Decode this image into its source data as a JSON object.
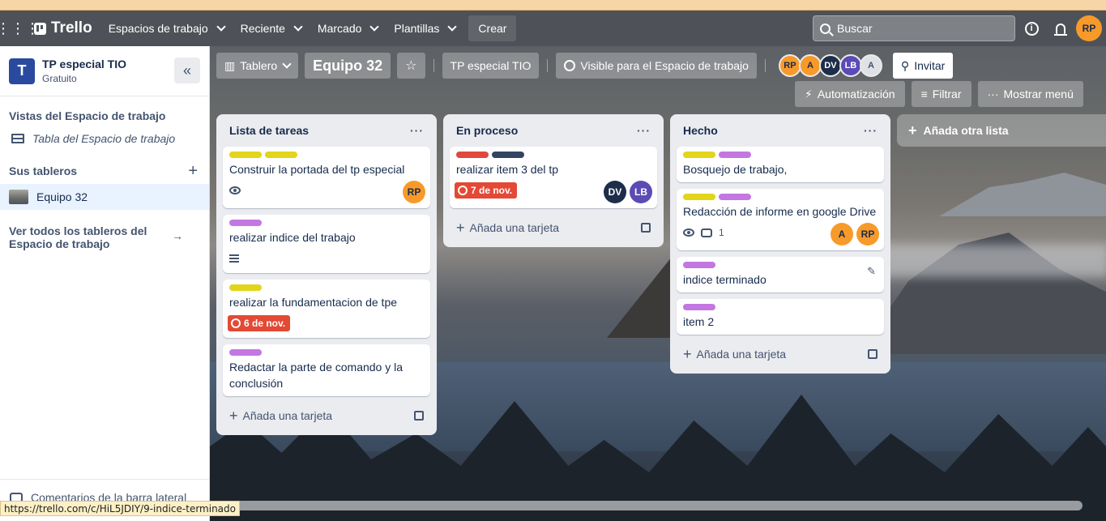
{
  "topbar": {
    "brand": "Trello",
    "nav": [
      "Espacios de trabajo",
      "Reciente",
      "Marcado",
      "Plantillas"
    ],
    "create_label": "Crear",
    "search_placeholder": "Buscar",
    "user_initials": "RP"
  },
  "sidebar": {
    "workspace_initial": "T",
    "workspace_name": "TP especial TIO",
    "workspace_plan": "Gratuito",
    "views_heading": "Vistas del Espacio de trabajo",
    "table_view_label": "Tabla del Espacio de trabajo",
    "boards_heading": "Sus tableros",
    "board_item": "Equipo 32",
    "see_all": "Ver todos los tableros del Espacio de trabajo",
    "bottom_label": "Comentarios de la barra lateral"
  },
  "board": {
    "view_label": "Tablero",
    "title": "Equipo 32",
    "workspace_button": "TP especial TIO",
    "visibility": "Visible para el Espacio de trabajo",
    "members": [
      "RP",
      "A",
      "DV",
      "LB",
      "A"
    ],
    "invite_label": "Invitar",
    "automation_label": "Automatización",
    "filter_label": "Filtrar",
    "menu_label": "Mostrar menú",
    "add_list_label": "Añada otra lista",
    "add_card_label": "Añada una tarjeta"
  },
  "lists": [
    {
      "title": "Lista de tareas",
      "cards": [
        {
          "title": "Construir la portada del tp especial",
          "labels": [
            "yellow",
            "yellow"
          ],
          "watch": true,
          "members": [
            "RP"
          ]
        },
        {
          "title": "realizar indice del trabajo",
          "labels": [
            "purple"
          ],
          "description": true
        },
        {
          "title": "realizar la fundamentacion de tpe",
          "labels": [
            "yellow"
          ],
          "due": "6 de nov."
        },
        {
          "title": "Redactar la parte de comando y la conclusión",
          "labels": [
            "purple"
          ]
        }
      ]
    },
    {
      "title": "En proceso",
      "cards": [
        {
          "title": "realizar item 3 del tp",
          "labels": [
            "red",
            "navy"
          ],
          "due": "7 de nov.",
          "members": [
            "DV",
            "LB"
          ]
        }
      ]
    },
    {
      "title": "Hecho",
      "cards": [
        {
          "title": "Bosquejo de trabajo,",
          "labels": [
            "yellow",
            "purple"
          ]
        },
        {
          "title": "Redacción de informe en google Drive",
          "labels": [
            "yellow",
            "purple"
          ],
          "watch": true,
          "comments": "1",
          "members": [
            "A",
            "RP"
          ]
        },
        {
          "title": "indice terminado",
          "labels": [
            "purple"
          ],
          "edit": true
        },
        {
          "title": "item 2",
          "labels": [
            "purple"
          ]
        }
      ]
    }
  ],
  "colors": {
    "yellow": "#e2d51b",
    "purple": "#c377e0",
    "red": "#e2483d",
    "navy": "#344563",
    "orange_avatar": "#f79a2a",
    "navy_avatar": "#1d2d4a",
    "purple_avatar": "#5a4bb5",
    "gray_avatar": "#dfe1e6",
    "due_red": "#e34935"
  },
  "status_url": "https://trello.com/c/HiL5JDIY/9-indice-terminado"
}
